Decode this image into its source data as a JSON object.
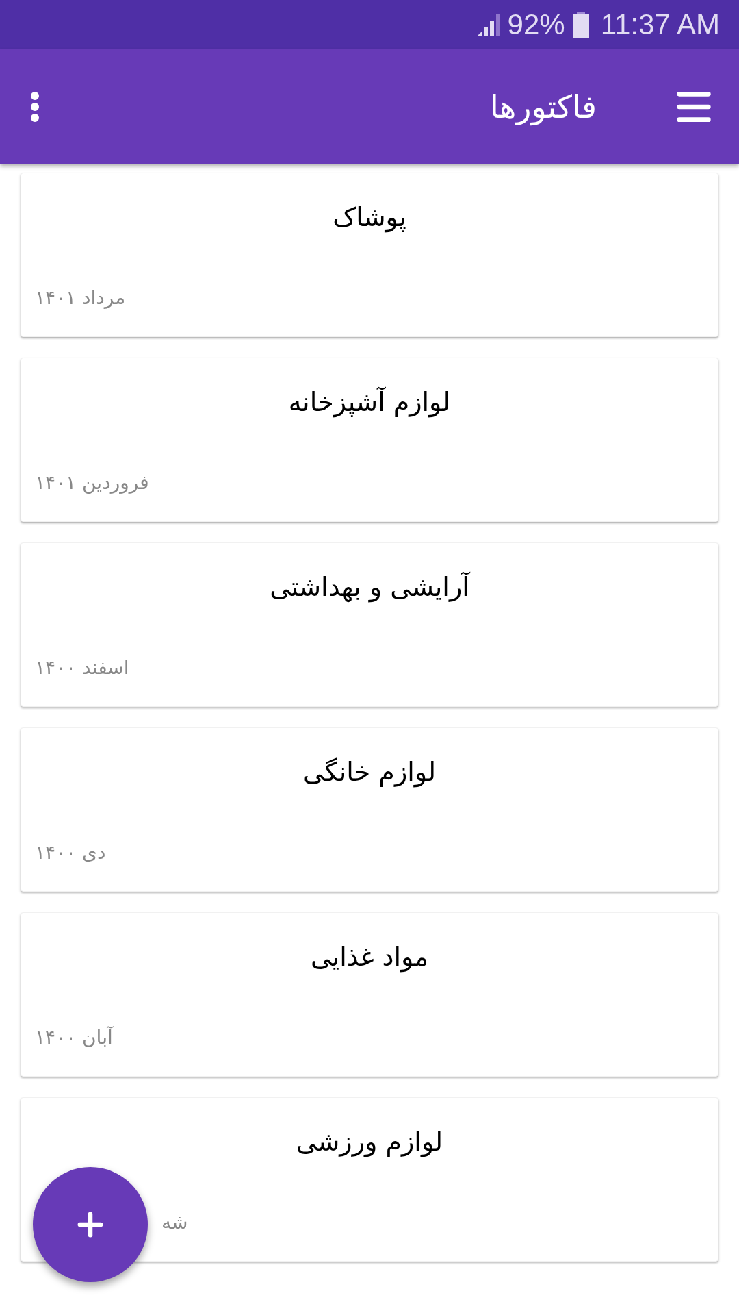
{
  "status_bar": {
    "battery": "92%",
    "time": "11:37 AM"
  },
  "app_bar": {
    "title": "فاکتورها"
  },
  "invoices": [
    {
      "title": "پوشاک",
      "date": "مرداد ۱۴۰۱"
    },
    {
      "title": "لوازم آشپزخانه",
      "date": "فروردین ۱۴۰۱"
    },
    {
      "title": "آرایشی و بهداشتی",
      "date": "اسفند ۱۴۰۰"
    },
    {
      "title": "لوازم خانگی",
      "date": "دی ۱۴۰۰"
    },
    {
      "title": "مواد غذایی",
      "date": "آبان ۱۴۰۰"
    },
    {
      "title": "لوازم ورزشی",
      "date": "شه"
    }
  ]
}
